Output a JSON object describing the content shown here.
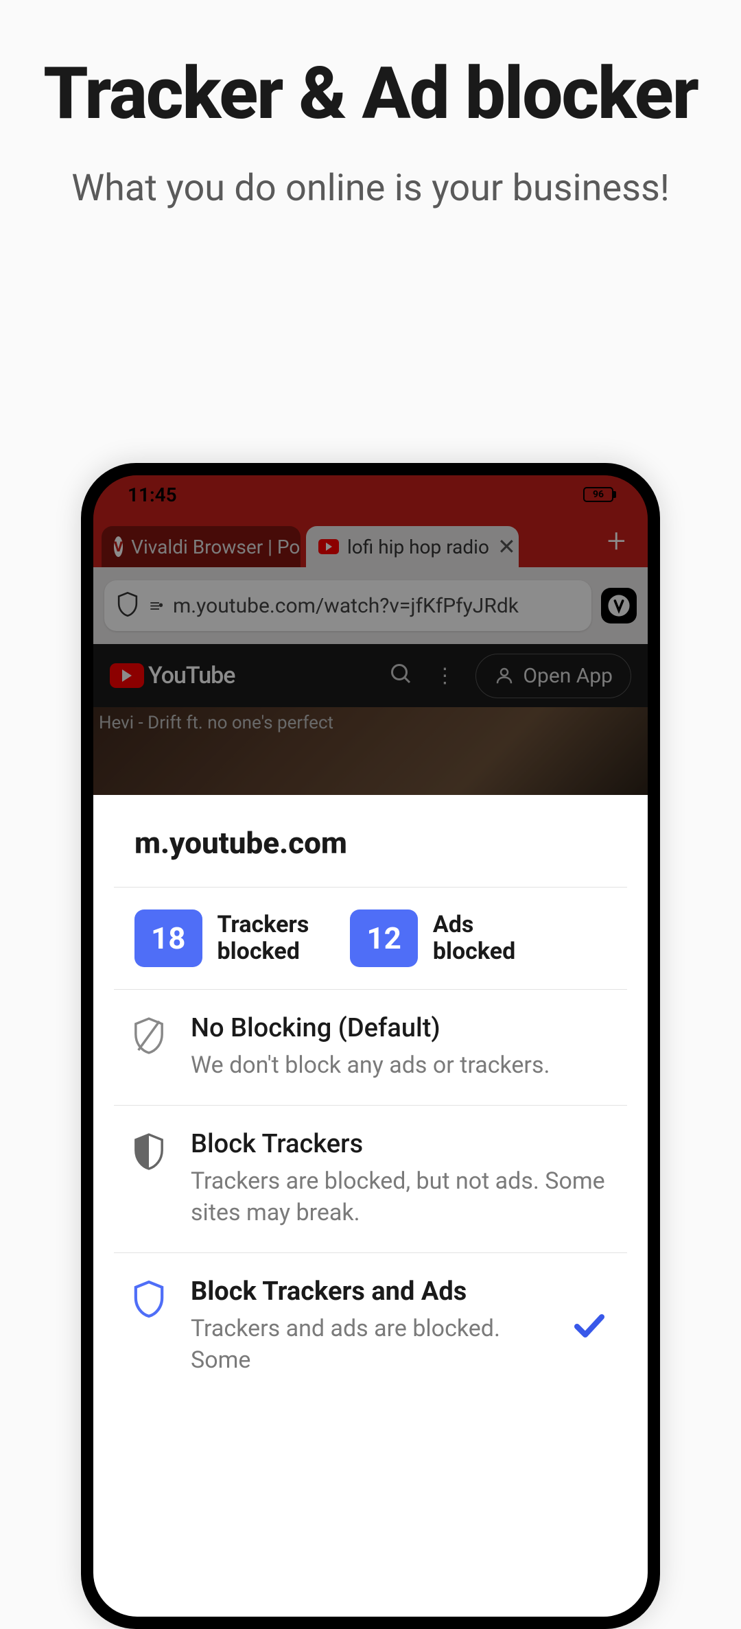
{
  "hero": {
    "title": "Tracker & Ad blocker",
    "subtitle": "What you do online is your business!"
  },
  "phone": {
    "status": {
      "time": "11:45",
      "battery": "96"
    },
    "tabs": [
      {
        "label": "Vivaldi Browser | Po",
        "active": false
      },
      {
        "label": "lofi hip hop radio",
        "active": true
      }
    ],
    "url": "m.youtube.com/watch?v=jfKfPfyJRdk",
    "page": {
      "site_name": "YouTube",
      "open_app_label": "Open App",
      "video_overlay_text": "Hevi - Drift ft. no one's perfect"
    }
  },
  "sheet": {
    "domain": "m.youtube.com",
    "stats": {
      "trackers": {
        "count": "18",
        "label_l1": "Trackers",
        "label_l2": "blocked"
      },
      "ads": {
        "count": "12",
        "label_l1": "Ads",
        "label_l2": "blocked"
      }
    },
    "options": [
      {
        "title": "No Blocking (Default)",
        "desc": "We don't block any ads or trackers.",
        "selected": false
      },
      {
        "title": "Block Trackers",
        "desc": "Trackers are blocked, but not ads. Some sites may break.",
        "selected": false
      },
      {
        "title": "Block Trackers and Ads",
        "desc": "Trackers and ads are blocked. Some",
        "selected": true
      }
    ]
  }
}
